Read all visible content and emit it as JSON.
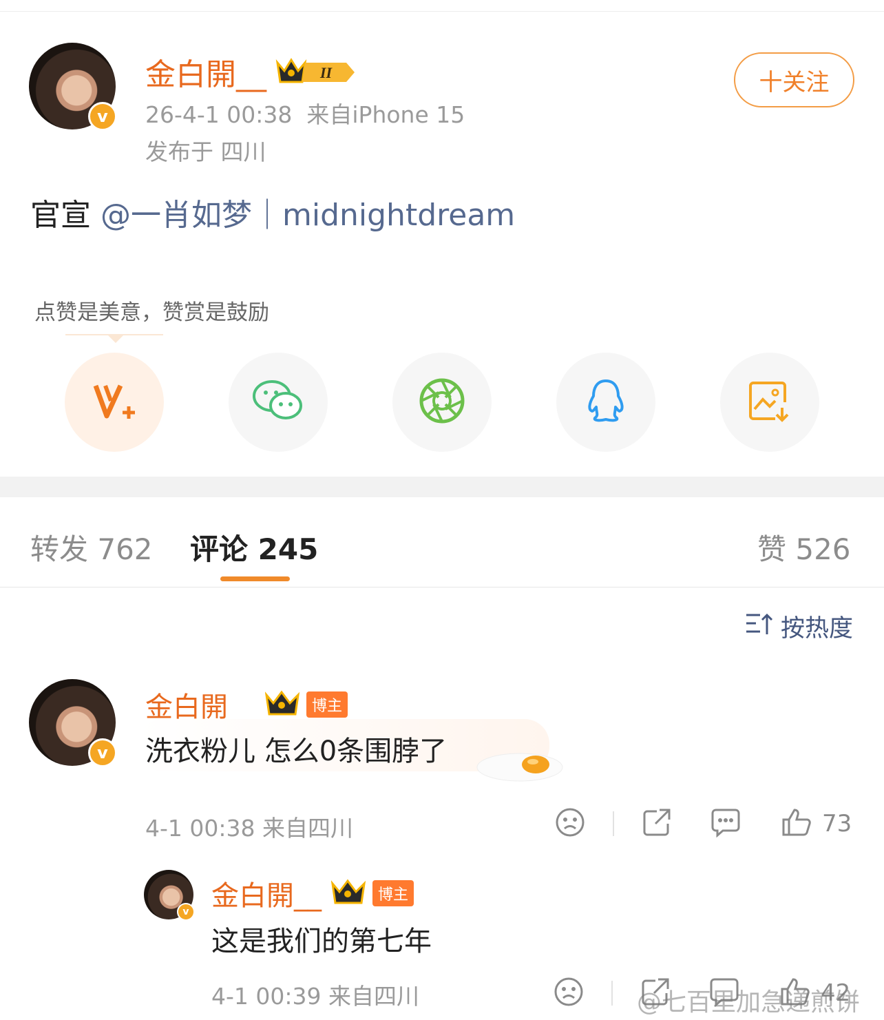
{
  "post": {
    "author": "金白開__",
    "date": "26-4-1 00:38",
    "source": "来自iPhone 15",
    "location": "发布于 四川",
    "follow_label": "十关注",
    "text_prefix": "官宣",
    "mention": "@一肖如梦｜midnightdream",
    "level": "II"
  },
  "reward_tip": "点赞是美意，赞赏是鼓励",
  "share_icons": [
    "v-plus-reward-icon",
    "wechat-icon",
    "moments-icon",
    "qq-icon",
    "save-image-icon"
  ],
  "tabs": {
    "repost": "转发 762",
    "comment": "评论 245",
    "like": "赞 526"
  },
  "sort_label": "按热度",
  "comments": [
    {
      "author": "金白開__",
      "badge": "博主",
      "text": "洗衣粉儿 怎么0条围脖了",
      "time": "4-1 00:38 来自四川",
      "likes": "73"
    },
    {
      "author": "金白開__",
      "badge": "博主",
      "text": "这是我们的第七年",
      "time": "4-1 00:39 来自四川",
      "likes": "42"
    }
  ],
  "watermark": "@七百里加急递煎饼",
  "colors": {
    "accent": "#e8691e",
    "link": "#56698f",
    "follow": "#f39c45"
  }
}
